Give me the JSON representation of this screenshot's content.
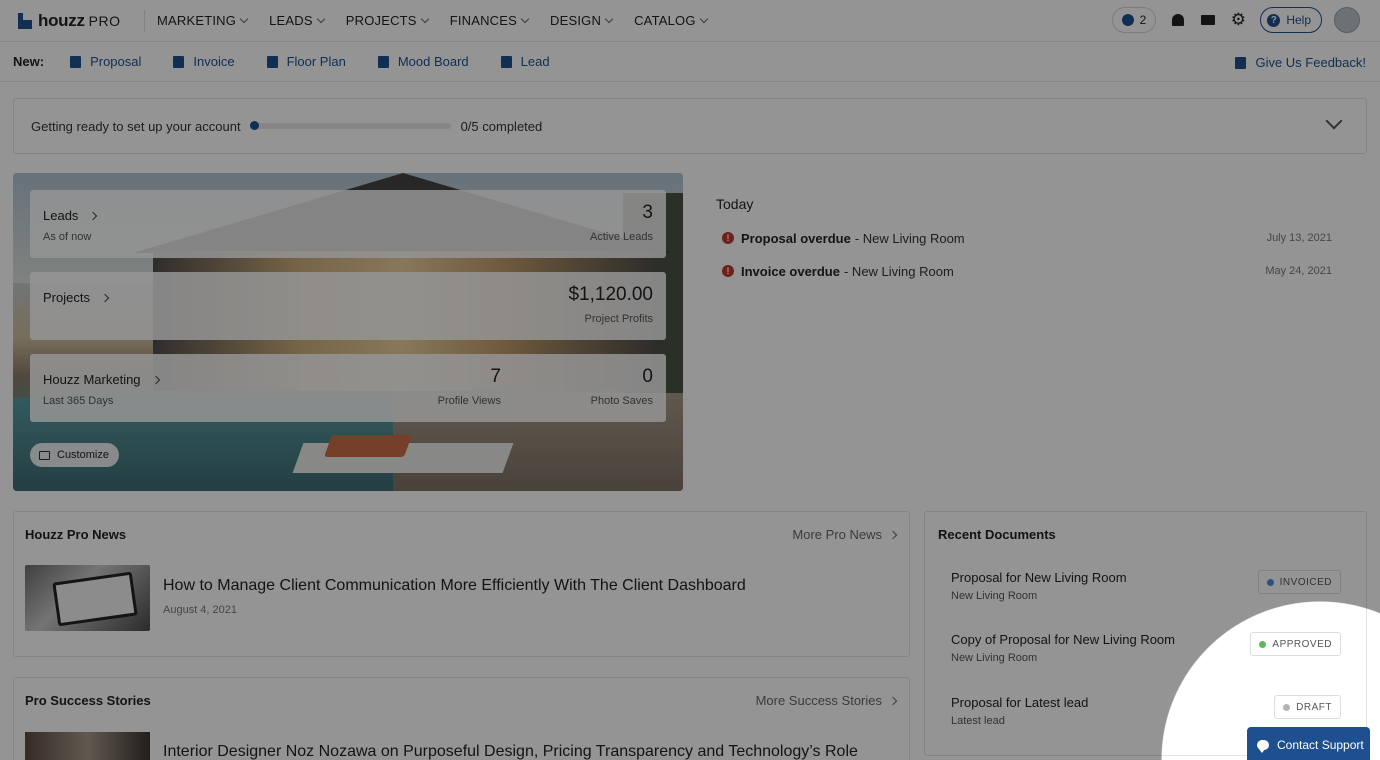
{
  "header": {
    "logo": "houzz",
    "logo_suffix": "PRO",
    "nav": [
      "MARKETING",
      "LEADS",
      "PROJECTS",
      "FINANCES",
      "DESIGN",
      "CATALOG"
    ],
    "timer_count": "2",
    "help_label": "Help"
  },
  "new_bar": {
    "label": "New:",
    "items": [
      {
        "label": "Proposal",
        "icon": "proposal-icon"
      },
      {
        "label": "Invoice",
        "icon": "invoice-icon"
      },
      {
        "label": "Floor Plan",
        "icon": "floor-plan-icon"
      },
      {
        "label": "Mood Board",
        "icon": "mood-board-icon"
      },
      {
        "label": "Lead",
        "icon": "lead-icon"
      }
    ],
    "feedback": "Give Us Feedback!"
  },
  "setup": {
    "text": "Getting ready to set up your account",
    "progress_fraction": 0.0,
    "completed": "0/5 completed"
  },
  "stats": {
    "leads": {
      "title": "Leads",
      "sub": "As of now",
      "value": "3",
      "label": "Active Leads"
    },
    "projects": {
      "title": "Projects",
      "value": "$1,120.00",
      "label": "Project Profits"
    },
    "marketing": {
      "title": "Houzz Marketing",
      "sub": "Last 365 Days",
      "views_value": "7",
      "views_label": "Profile Views",
      "saves_value": "0",
      "saves_label": "Photo Saves"
    },
    "customize": "Customize"
  },
  "today": {
    "title": "Today",
    "items": [
      {
        "bold": "Proposal overdue",
        "rest": "- New Living Room",
        "date": "July 13, 2021"
      },
      {
        "bold": "Invoice overdue",
        "rest": "- New Living Room",
        "date": "May 24, 2021"
      }
    ]
  },
  "news": {
    "title": "Houzz Pro News",
    "more": "More Pro News",
    "headline": "How to Manage Client Communication More Efficiently With The Client Dashboard",
    "date": "August 4, 2021"
  },
  "stories": {
    "title": "Pro Success Stories",
    "more": "More Success Stories",
    "headline": "Interior Designer Noz Nozawa on Purposeful Design, Pricing Transparency and Technology’s Role"
  },
  "recent_docs": {
    "title": "Recent Documents",
    "items": [
      {
        "name": "Proposal for New Living Room",
        "sub": "New Living Room",
        "status": "INVOICED",
        "color": "#4a90d9"
      },
      {
        "name": "Copy of Proposal for New Living Room",
        "sub": "New Living Room",
        "status": "APPROVED",
        "color": "#5cb85c"
      },
      {
        "name": "Proposal for Latest lead",
        "sub": "Latest lead",
        "status": "DRAFT",
        "color": "#b5b5b5"
      }
    ]
  },
  "support": {
    "label": "Contact Support"
  }
}
